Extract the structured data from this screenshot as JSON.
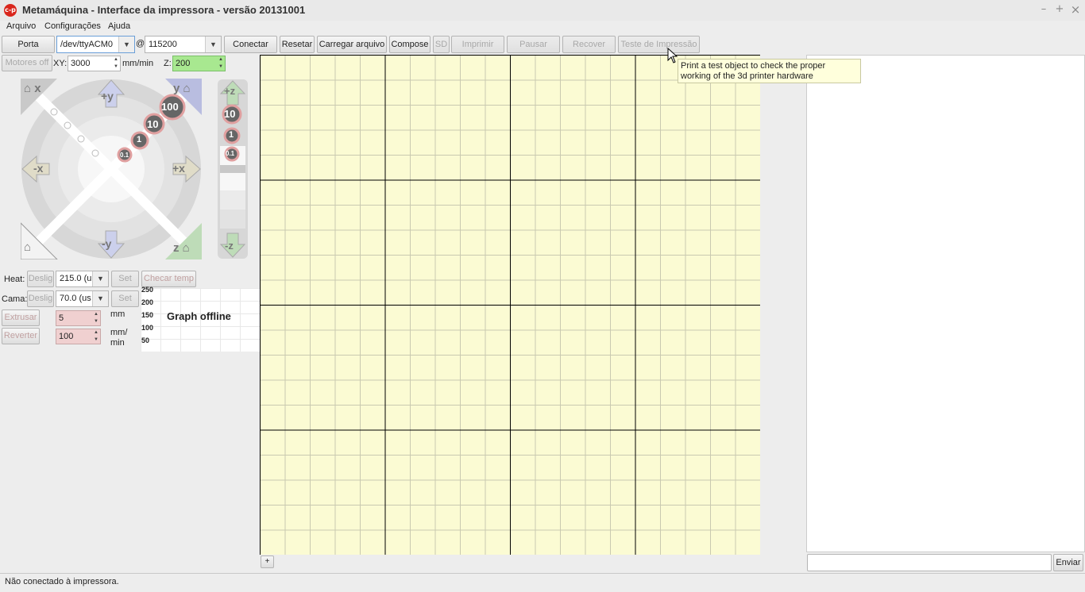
{
  "window": {
    "title": "Metamáquina - Interface da impressora - versão 20131001",
    "app_icon": "metamaquina-logo-icon",
    "min": "–",
    "max": "+",
    "close": "×"
  },
  "menu": [
    "Arquivo",
    "Configurações",
    "Ajuda"
  ],
  "toolbar": {
    "port_button": "Porta",
    "port_value": "/dev/ttyACM0",
    "at": "@",
    "baud_value": "115200",
    "connect": "Conectar",
    "reset": "Resetar",
    "load_file": "Carregar arquivo",
    "compose": "Compose",
    "sd": "SD",
    "print": "Imprimir",
    "pause": "Pausar",
    "recover": "Recover",
    "test_print": "Teste de Impressão"
  },
  "tooltip": "Print a test object to check the proper working of the 3d printer hardware",
  "motion": {
    "motors_off": "Motores off",
    "xy_label": "XY:",
    "xy_value": "3000",
    "unit": "mm/min",
    "z_label": "Z:",
    "z_value": "200"
  },
  "jog": {
    "home_x": "x",
    "home_y": "y",
    "home_z": "z",
    "plus_y": "+y",
    "minus_y": "-y",
    "plus_x": "+x",
    "minus_x": "-x",
    "steps": [
      "100",
      "10",
      "1",
      "0.1"
    ],
    "plus_z": "+z",
    "minus_z": "-z",
    "z_steps": [
      "10",
      "1",
      "0.1"
    ]
  },
  "temp": {
    "heat_label": "Heat:",
    "heat_off": "Deslig",
    "heat_value": "215.0 (u",
    "set": "Set",
    "check_temp": "Checar temp",
    "bed_label": "Cama:",
    "bed_off": "Deslig",
    "bed_value": "70.0 (us"
  },
  "extrude": {
    "extrude_btn": "Extrusar",
    "extrude_value": "5",
    "mm": "mm",
    "reverse_btn": "Reverter",
    "feed_value": "100",
    "feed_unit_1": "mm/",
    "feed_unit_2": "min"
  },
  "graph": {
    "status": "Graph offline",
    "ticks": [
      "250",
      "200",
      "150",
      "100",
      "50"
    ]
  },
  "platter_add": "+",
  "send": "Enviar",
  "status": "Não conectado à impressora."
}
